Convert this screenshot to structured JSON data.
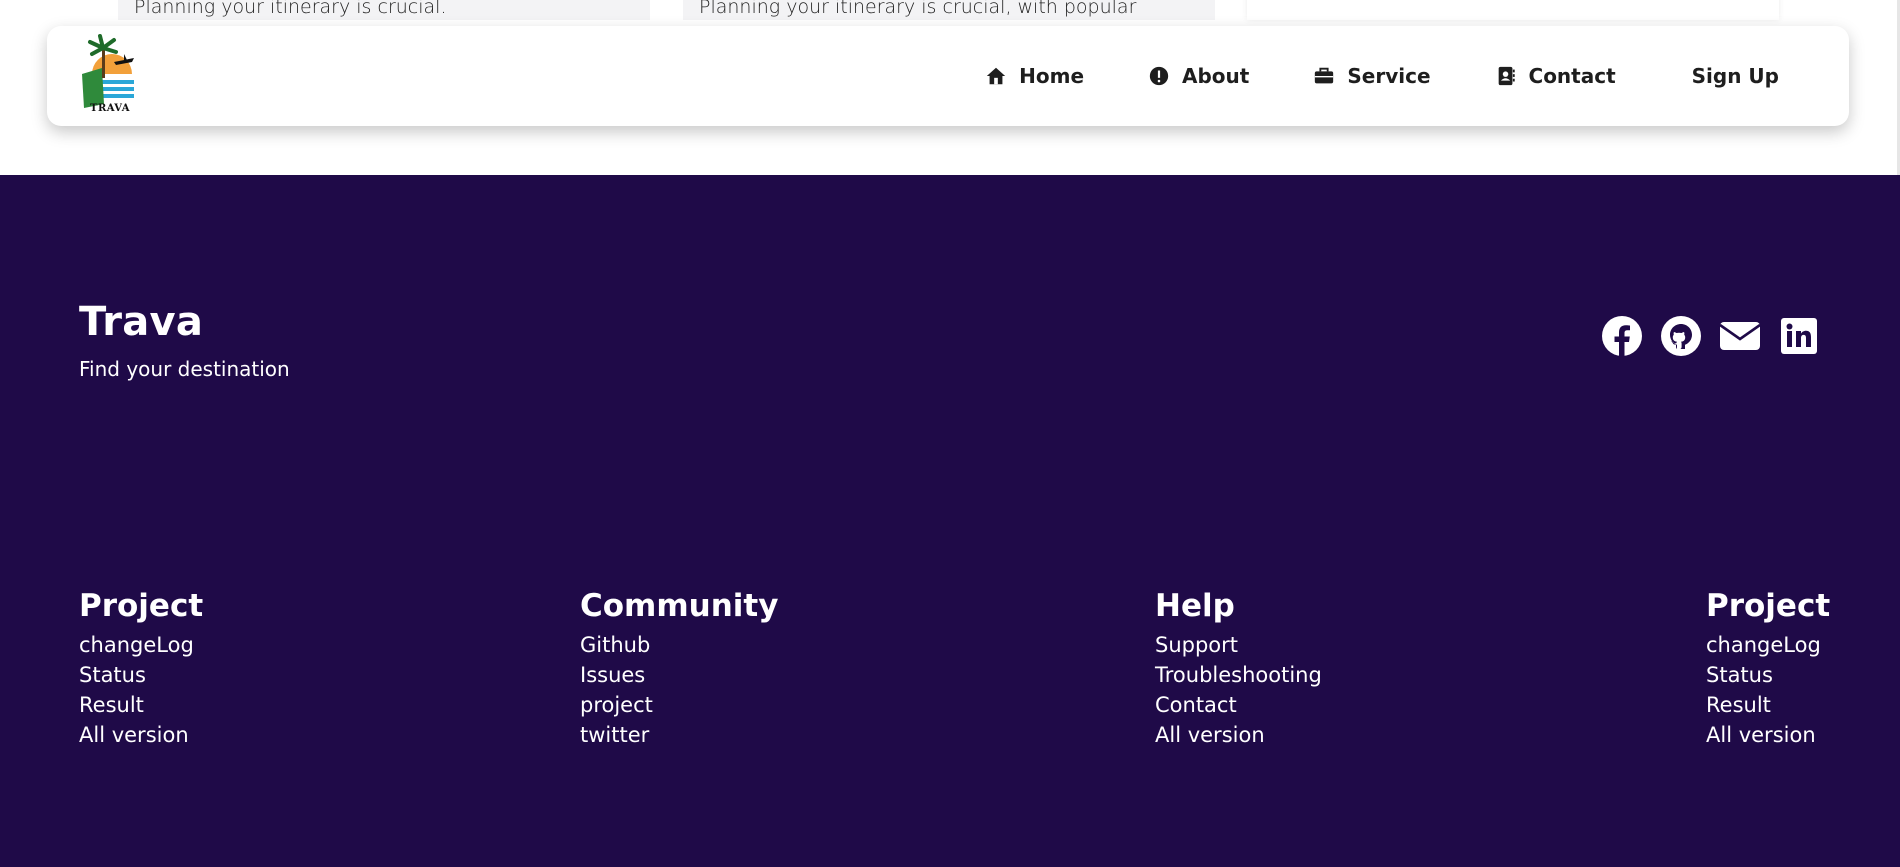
{
  "background_cards": [
    {
      "text": "Planning your itinerary is crucial."
    },
    {
      "text": "Planning your itinerary is crucial, with popular"
    },
    {
      "text": ""
    }
  ],
  "navbar": {
    "logo_alt": "TRAVA",
    "items": [
      {
        "label": "Home",
        "icon": "home-icon"
      },
      {
        "label": "About",
        "icon": "info-icon"
      },
      {
        "label": "Service",
        "icon": "briefcase-icon"
      },
      {
        "label": "Contact",
        "icon": "contact-book-icon"
      }
    ],
    "signup_label": "Sign Up"
  },
  "footer": {
    "brand": "Trava",
    "tagline": "Find your destination",
    "socials": [
      "facebook-icon",
      "github-icon",
      "mail-icon",
      "linkedin-icon"
    ],
    "columns": [
      {
        "title": "Project",
        "links": [
          "changeLog",
          "Status",
          "Result",
          "All version"
        ]
      },
      {
        "title": "Community",
        "links": [
          "Github",
          "Issues",
          "project",
          "twitter"
        ]
      },
      {
        "title": "Help",
        "links": [
          "Support",
          "Troubleshooting",
          "Contact",
          "All version"
        ]
      },
      {
        "title": "Project",
        "links": [
          "changeLog",
          "Status",
          "Result",
          "All version"
        ]
      }
    ]
  },
  "colors": {
    "footer_bg": "#1f0a48",
    "nav_bg": "#ffffff",
    "text_dark": "#1e1e1e"
  }
}
